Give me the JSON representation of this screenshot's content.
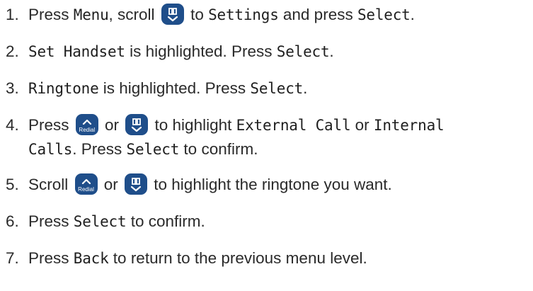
{
  "steps": [
    {
      "number": "1.",
      "parts": [
        "Press ",
        "Menu",
        ", scroll ",
        "",
        " to ",
        "Settings",
        " and press ",
        "Select",
        "."
      ]
    },
    {
      "number": "2.",
      "parts": [
        "Set Handset",
        " is highlighted. Press ",
        "Select",
        "."
      ]
    },
    {
      "number": "3.",
      "parts": [
        "Ringtone",
        " is highlighted. Press ",
        "Select",
        "."
      ]
    },
    {
      "number": "4.",
      "parts": [
        "Press ",
        "",
        " or ",
        "",
        " to highlight ",
        "External Call",
        " or ",
        "Internal",
        " ",
        "Calls",
        ". Press ",
        "Select",
        " to confirm."
      ]
    },
    {
      "number": "5.",
      "parts": [
        "Scroll ",
        "",
        " or ",
        "",
        " to highlight the ringtone you want."
      ]
    },
    {
      "number": "6.",
      "parts": [
        "Press ",
        "Select",
        " to confirm."
      ]
    },
    {
      "number": "7.",
      "parts": [
        "Press ",
        "Back",
        " to return to the previous menu level."
      ]
    }
  ],
  "keys": {
    "redial_label": "Redial",
    "redial_icon": "redial-up-key-icon",
    "phonebook_icon": "phonebook-down-key-icon",
    "key_color": "#1f4e8a"
  }
}
